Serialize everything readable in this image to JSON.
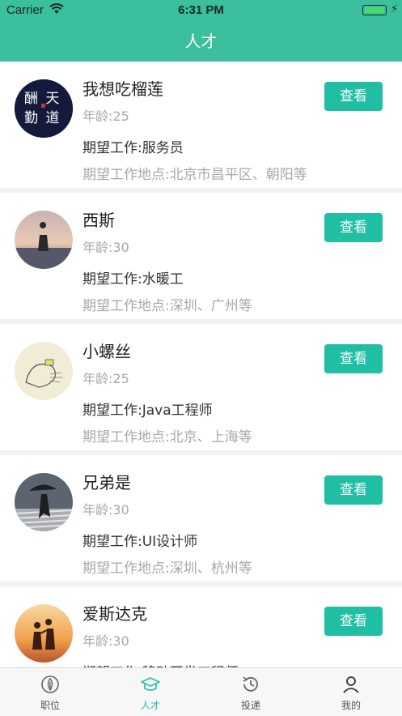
{
  "status_bar": {
    "carrier": "Carrier",
    "time": "6:31 PM"
  },
  "nav": {
    "title": "人才"
  },
  "candidates": [
    {
      "name": "我想吃榴莲",
      "age": "年龄:25",
      "job": "期望工作:服务员",
      "location": "期望工作地点:北京市昌平区、朝阳等",
      "button": "查看",
      "avatar_text": "酬 天 勤 道"
    },
    {
      "name": "西斯",
      "age": "年龄:30",
      "job": "期望工作:水暖工",
      "location": "期望工作地点:深圳、广州等",
      "button": "查看"
    },
    {
      "name": "小螺丝",
      "age": "年龄:25",
      "job": "期望工作:Java工程师",
      "location": "期望工作地点:北京、上海等",
      "button": "查看"
    },
    {
      "name": "兄弟是",
      "age": "年龄:30",
      "job": "期望工作:UI设计师",
      "location": "期望工作地点:深圳、杭州等",
      "button": "查看"
    },
    {
      "name": "爱斯达克",
      "age": "年龄:30",
      "job": "期望工作:移动开发工程师",
      "location": "",
      "button": "查看"
    }
  ],
  "tabs": [
    {
      "label": "职位",
      "icon": "job-icon"
    },
    {
      "label": "人才",
      "icon": "talent-icon",
      "active": true
    },
    {
      "label": "投递",
      "icon": "history-icon"
    },
    {
      "label": "我的",
      "icon": "profile-icon"
    }
  ],
  "colors": {
    "accent": "#20bfa3",
    "header": "#3cbf9e"
  }
}
